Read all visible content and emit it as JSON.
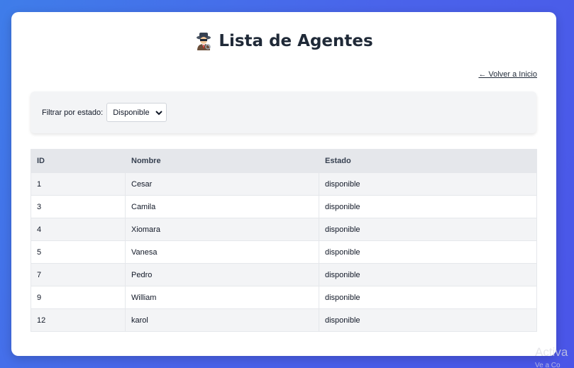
{
  "header": {
    "title": "Lista de Agentes",
    "icon": "detective-icon"
  },
  "nav": {
    "back_link": "← Volver a Inicio"
  },
  "filter": {
    "label": "Filtrar por estado:",
    "selected": "Disponible"
  },
  "table": {
    "columns": [
      "ID",
      "Nombre",
      "Estado"
    ],
    "rows": [
      {
        "id": "1",
        "nombre": "Cesar",
        "estado": "disponible"
      },
      {
        "id": "3",
        "nombre": "Camila",
        "estado": "disponible"
      },
      {
        "id": "4",
        "nombre": "Xiomara",
        "estado": "disponible"
      },
      {
        "id": "5",
        "nombre": "Vanesa",
        "estado": "disponible"
      },
      {
        "id": "7",
        "nombre": "Pedro",
        "estado": "disponible"
      },
      {
        "id": "9",
        "nombre": "William",
        "estado": "disponible"
      },
      {
        "id": "12",
        "nombre": "karol",
        "estado": "disponible"
      }
    ]
  },
  "watermark": {
    "line1": "Activa",
    "line2": "Ve a Co"
  },
  "colors": {
    "background_start": "#3f7de9",
    "background_end": "#4a55e8",
    "card": "#ffffff",
    "header_row": "#e5e7eb",
    "stripe": "#f3f4f6"
  }
}
